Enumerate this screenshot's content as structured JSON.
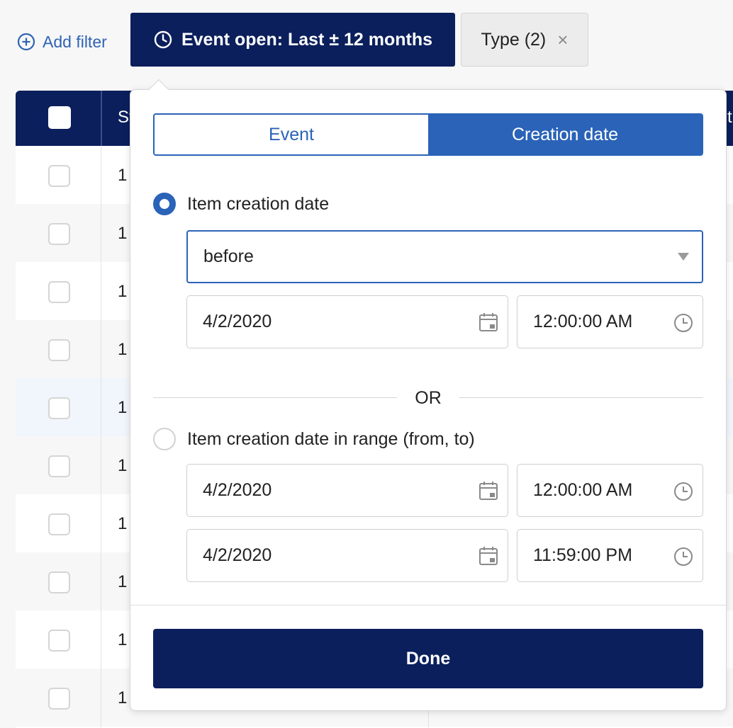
{
  "filter_bar": {
    "add_filter_label": "Add filter",
    "event_open_label": "Event open: Last ± 12 months",
    "type_label": "Type (2)",
    "type_remove": "×"
  },
  "table": {
    "header_first": "St",
    "header_last": "t",
    "row_prefix": "1"
  },
  "popover": {
    "tabs": [
      {
        "label": "Event",
        "selected": false
      },
      {
        "label": "Creation date",
        "selected": true
      }
    ],
    "option_single": {
      "label": "Item creation date",
      "selected": true,
      "operator": "before",
      "date": "4/2/2020",
      "time": "12:00:00 AM"
    },
    "or_label": "OR",
    "option_range": {
      "label": "Item creation date in range (from, to)",
      "selected": false,
      "from_date": "4/2/2020",
      "from_time": "12:00:00 AM",
      "to_date": "4/2/2020",
      "to_time": "11:59:00 PM"
    },
    "done_label": "Done"
  },
  "colors": {
    "navy": "#0b1f5c",
    "accent_blue": "#2a63b8",
    "link_blue": "#2f63b5"
  }
}
